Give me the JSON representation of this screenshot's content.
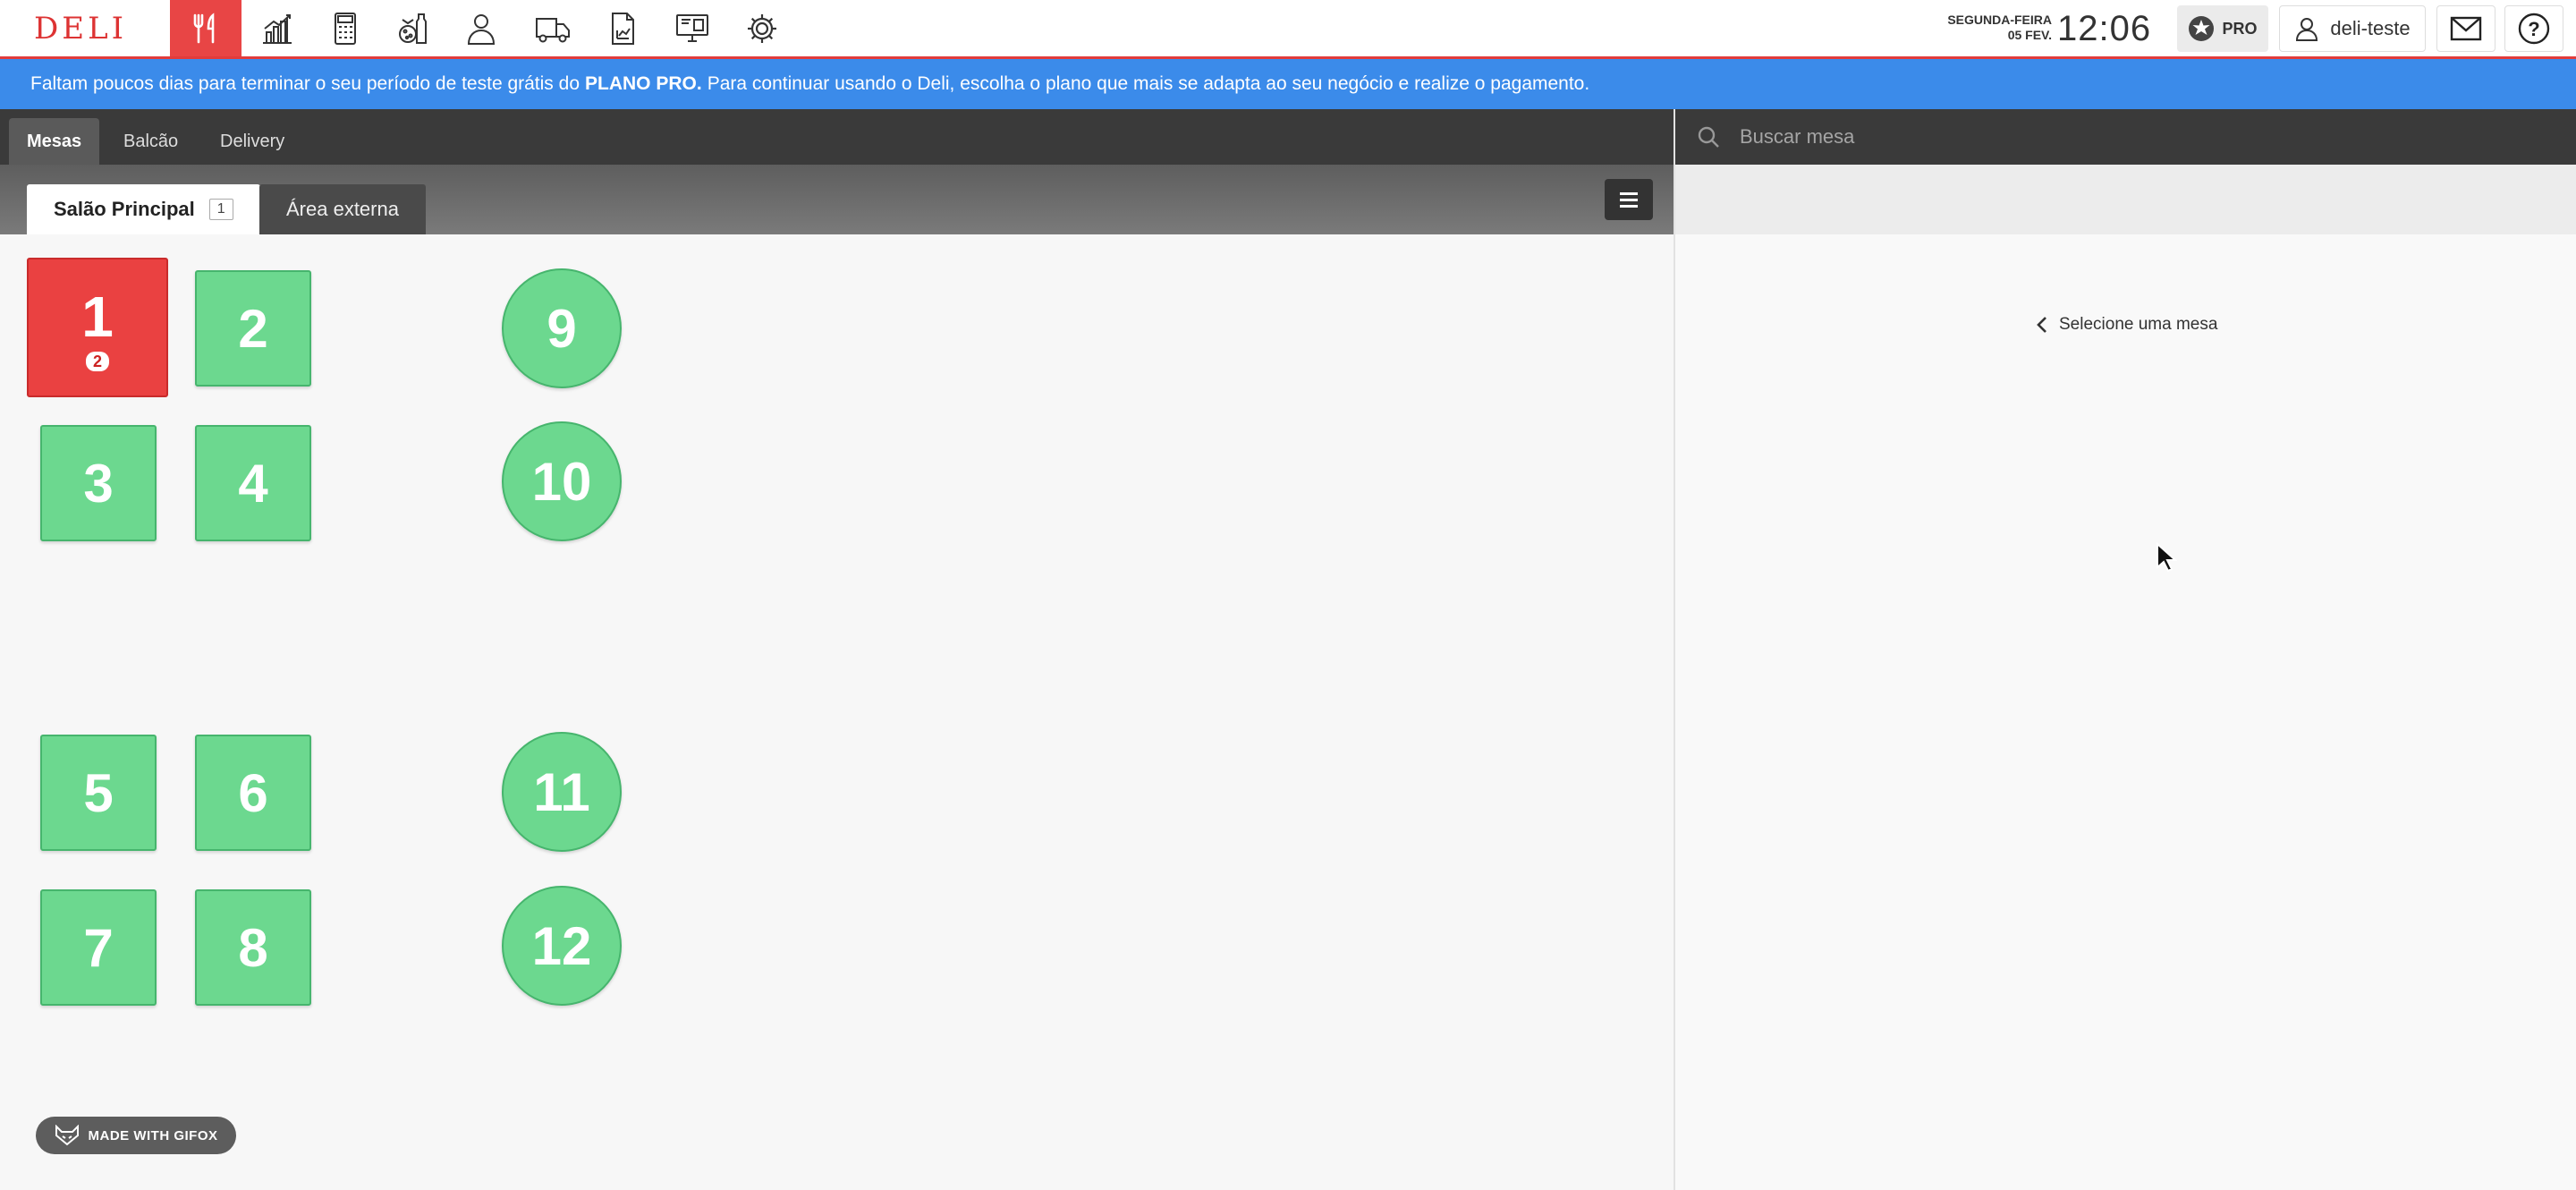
{
  "app": {
    "logo": "DELI"
  },
  "nav": {
    "icons": [
      "restaurant-icon",
      "chart-icon",
      "calculator-icon",
      "products-icon",
      "user-icon",
      "delivery-truck-icon",
      "report-icon",
      "monitor-icon",
      "gear-icon"
    ],
    "active": "restaurant-icon"
  },
  "header": {
    "weekday": "SEGUNDA-FEIRA",
    "date": "05 FEV.",
    "time": "12:06",
    "pro_label": "PRO",
    "username": "deli-teste"
  },
  "banner": {
    "text_before": "Faltam poucos dias para terminar o seu período de teste grátis do",
    "plan": "PLANO PRO.",
    "text_after": "Para continuar usando o Deli, escolha o plano que mais se adapta ao seu negócio e realize o pagamento."
  },
  "tabs": [
    {
      "label": "Mesas",
      "active": true
    },
    {
      "label": "Balcão",
      "active": false
    },
    {
      "label": "Delivery",
      "active": false
    }
  ],
  "areas": [
    {
      "label": "Salão Principal",
      "count": "1",
      "active": true
    },
    {
      "label": "Área externa",
      "active": false
    }
  ],
  "search": {
    "placeholder": "Buscar mesa"
  },
  "detail": {
    "hint": "Selecione uma mesa"
  },
  "tables": [
    {
      "number": "1",
      "status": "occupied",
      "guests": "2"
    },
    {
      "number": "2",
      "status": "free"
    },
    {
      "number": "3",
      "status": "free"
    },
    {
      "number": "4",
      "status": "free"
    },
    {
      "number": "5",
      "status": "free"
    },
    {
      "number": "6",
      "status": "free"
    },
    {
      "number": "7",
      "status": "free"
    },
    {
      "number": "8",
      "status": "free"
    },
    {
      "number": "9",
      "status": "free"
    },
    {
      "number": "10",
      "status": "free"
    },
    {
      "number": "11",
      "status": "free"
    },
    {
      "number": "12",
      "status": "free"
    }
  ],
  "watermark": "MADE WITH GIFOX",
  "colors": {
    "brand_red": "#e84545",
    "banner_blue": "#3b8bea",
    "table_free": "#6cd88f",
    "table_busy": "#ea4141"
  }
}
